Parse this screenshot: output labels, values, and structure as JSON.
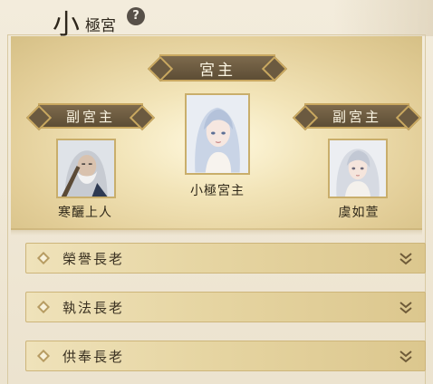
{
  "header": {
    "title_big": "小",
    "title_small": "極宮",
    "help_icon": "help-icon"
  },
  "leadership": {
    "main_title": "宮主",
    "vice_title": "副宮主",
    "main_name": "小極宮主",
    "left_name": "寒釃上人",
    "right_name": "虞如萱"
  },
  "elders": [
    {
      "label": "榮譽長老",
      "icon": "chevron-down-icon"
    },
    {
      "label": "執法長老",
      "icon": "chevron-down-icon"
    },
    {
      "label": "供奉長老",
      "icon": "chevron-down-icon"
    }
  ],
  "colors": {
    "banner": "#6b5a40",
    "gold_border": "#c9a860",
    "text_dark": "#2f2819"
  }
}
